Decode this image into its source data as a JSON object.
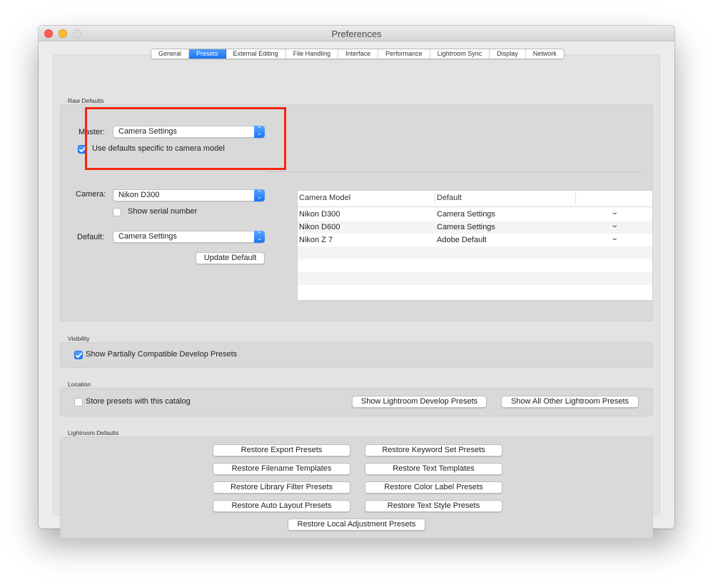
{
  "window": {
    "title": "Preferences"
  },
  "tabs": [
    {
      "label": "General",
      "active": false
    },
    {
      "label": "Presets",
      "active": true
    },
    {
      "label": "External Editing",
      "active": false
    },
    {
      "label": "File Handling",
      "active": false
    },
    {
      "label": "Interface",
      "active": false
    },
    {
      "label": "Performance",
      "active": false
    },
    {
      "label": "Lightroom Sync",
      "active": false
    },
    {
      "label": "Display",
      "active": false
    },
    {
      "label": "Network",
      "active": false
    }
  ],
  "raw_defaults": {
    "group_label": "Raw Defaults",
    "master_label": "Master:",
    "master_value": "Camera Settings",
    "use_camera_defaults_label": "Use defaults specific to camera model",
    "use_camera_defaults_checked": true,
    "camera_label": "Camera:",
    "camera_value": "Nikon D300",
    "show_serial_label": "Show serial number",
    "show_serial_checked": false,
    "default_label": "Default:",
    "default_value": "Camera Settings",
    "update_default_button": "Update Default",
    "table": {
      "headers": [
        "Camera Model",
        "Default",
        ""
      ],
      "rows": [
        {
          "model": "Nikon D300",
          "default": "Camera Settings"
        },
        {
          "model": "Nikon D600",
          "default": "Camera Settings"
        },
        {
          "model": "Nikon Z 7",
          "default": "Adobe Default"
        }
      ]
    }
  },
  "visibility": {
    "group_label": "Visibility",
    "show_partial_label": "Show Partially Compatible Develop Presets",
    "show_partial_checked": true
  },
  "location": {
    "group_label": "Location",
    "store_with_catalog_label": "Store presets with this catalog",
    "store_with_catalog_checked": false,
    "show_develop_button": "Show Lightroom Develop Presets",
    "show_other_button": "Show All Other Lightroom Presets"
  },
  "lightroom_defaults": {
    "group_label": "Lightroom Defaults",
    "buttons": [
      "Restore Export Presets",
      "Restore Keyword Set Presets",
      "Restore Filename Templates",
      "Restore Text Templates",
      "Restore Library Filter Presets",
      "Restore Color Label Presets",
      "Restore Auto Layout Presets",
      "Restore Text Style Presets",
      "Restore Local Adjustment Presets"
    ]
  },
  "icons": {
    "popup_stepper": "⌃⌄",
    "row_chevron": "⌄"
  },
  "colors": {
    "accent": "#1a74f2",
    "annotation_highlight": "#f4250f"
  }
}
